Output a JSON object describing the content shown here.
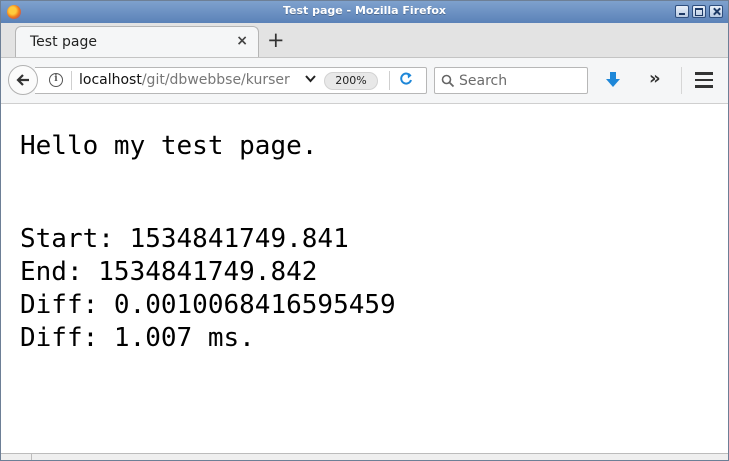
{
  "window": {
    "title": "Test page - Mozilla Firefox"
  },
  "tabs": [
    {
      "label": "Test page",
      "close": "×"
    }
  ],
  "new_tab": "+",
  "navbar": {
    "url_host": "localhost",
    "url_path": "/git/dbwebbse/kurser",
    "zoom": "200%",
    "search_placeholder": "Search",
    "overflow": "»",
    "dropdown": "⌄"
  },
  "content": {
    "heading": "Hello my test page.",
    "lines": [
      "Start: 1534841749.841",
      "End: 1534841749.842",
      "Diff: 0.0010068416595459",
      "Diff: 1.007 ms."
    ]
  },
  "colors": {
    "titlebar": "#5b82b8",
    "reload": "#1e87d8",
    "download": "#1e87d8"
  },
  "icons": [
    "firefox-logo-icon",
    "back-arrow-icon",
    "info-icon",
    "reload-icon",
    "search-icon",
    "download-arrow-icon",
    "overflow-chevrons-icon",
    "hamburger-menu-icon"
  ]
}
